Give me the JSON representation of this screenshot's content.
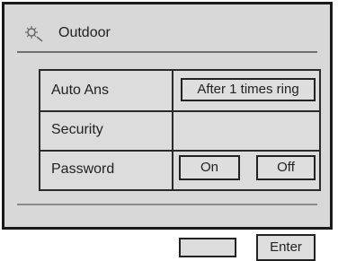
{
  "window": {
    "title": "Outdoor",
    "title_icon": "outdoor-gear-icon"
  },
  "settings": {
    "auto_answer": {
      "label": "Auto Ans",
      "value": "After 1 times ring"
    },
    "security": {
      "label": "Security",
      "on_label": "On",
      "off_label": "Off"
    },
    "password": {
      "label": "Password",
      "value": "",
      "enter_label": "Enter"
    }
  },
  "colors": {
    "background": "#d8d8d8",
    "border": "#1a1a1a",
    "text": "#222222"
  }
}
